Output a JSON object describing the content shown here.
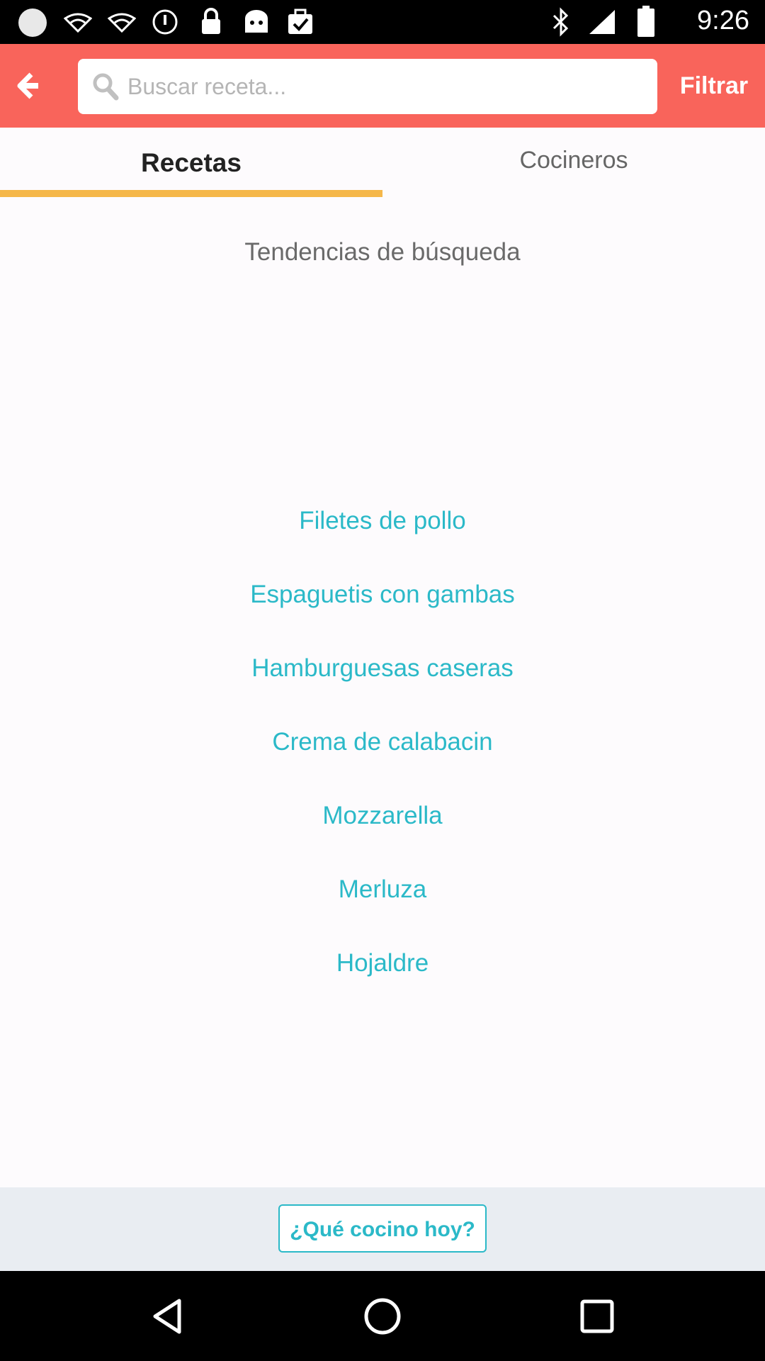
{
  "status_bar": {
    "time": "9:26",
    "left_icons": [
      "circle-icon",
      "wifi-icon",
      "wifi-icon",
      "alarm-icon",
      "lock-icon",
      "android-icon",
      "check-bag-icon"
    ],
    "right_icons": [
      "bluetooth-icon",
      "signal-icon",
      "battery-icon"
    ]
  },
  "app_bar": {
    "color": "#f9645b",
    "back_icon": "arrow-left-icon",
    "search": {
      "placeholder": "Buscar receta...",
      "value": ""
    },
    "filter_label": "Filtrar"
  },
  "tabs": [
    {
      "label": "Recetas",
      "active": true
    },
    {
      "label": "Cocineros",
      "active": false
    }
  ],
  "tab_indicator_color": "#f5b74a",
  "trends": {
    "title": "Tendencias de búsqueda",
    "items": [
      "Filetes de pollo",
      "Espaguetis con gambas",
      "Hamburguesas caseras",
      "Crema de calabacin",
      "Mozzarella",
      "Merluza",
      "Hojaldre"
    ],
    "link_color": "#2bb9c8"
  },
  "bottom": {
    "cta_label": "¿Qué cocino hoy?"
  },
  "nav_bar": {
    "icons": [
      "back-triangle-icon",
      "home-circle-icon",
      "recents-square-icon"
    ]
  }
}
